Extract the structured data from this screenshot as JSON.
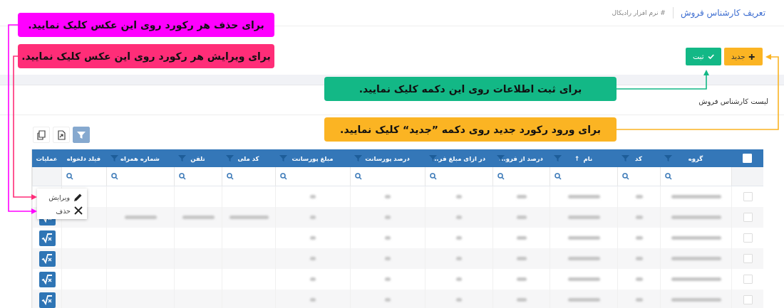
{
  "header": {
    "title": "تعریف کارشناس فروش",
    "breadcrumb": "# نرم افزار رادیکال"
  },
  "actions": [
    {
      "kind": "new",
      "label": "جدید"
    },
    {
      "kind": "save",
      "label": "ثبت"
    }
  ],
  "list_title": "لیست کارشناس فروش",
  "toolbar": [
    {
      "kind": "filter",
      "selected": true
    },
    {
      "kind": "export",
      "selected": false
    },
    {
      "kind": "columns",
      "selected": false
    }
  ],
  "table": {
    "columns": [
      {
        "label": "گروه",
        "filter": true
      },
      {
        "label": "کد",
        "filter": true
      },
      {
        "label": "نام",
        "filter": true,
        "sort_mark": "↑"
      },
      {
        "label": "درصد از فرو...",
        "filter": true
      },
      {
        "label": "در ازای مبلغ فر...",
        "filter": true
      },
      {
        "label": "درصد پورسانت",
        "filter": true
      },
      {
        "label": "مبلغ پورسانت",
        "filter": true
      },
      {
        "label": "کد ملی",
        "filter": true
      },
      {
        "label": "تلفن",
        "filter": true
      },
      {
        "label": "شماره همراه",
        "filter": true
      },
      {
        "label": "فیلد دلخواه",
        "filter": false
      },
      {
        "label": "عملیات",
        "filter": false
      }
    ],
    "header_checked": false,
    "rows": [
      {
        "checked": false,
        "cells": [
          true,
          true,
          true,
          true,
          true,
          true,
          true,
          false,
          false,
          false,
          false
        ],
        "actions_button": false
      },
      {
        "checked": false,
        "cells": [
          true,
          true,
          true,
          true,
          true,
          true,
          true,
          true,
          true,
          true,
          false
        ],
        "actions_button": true
      },
      {
        "checked": false,
        "cells": [
          true,
          true,
          true,
          true,
          true,
          true,
          true,
          false,
          false,
          false,
          false
        ]
      },
      {
        "checked": false,
        "cells": [
          true,
          true,
          true,
          true,
          true,
          true,
          true,
          false,
          false,
          false,
          false
        ]
      },
      {
        "checked": false,
        "cells": [
          true,
          true,
          true,
          true,
          true,
          true,
          true,
          false,
          false,
          false,
          false
        ]
      },
      {
        "checked": false,
        "cells": [
          true,
          true,
          true,
          true,
          true,
          true,
          true,
          false,
          false,
          false,
          false
        ]
      }
    ]
  },
  "row_menu": [
    {
      "kind": "edit",
      "label": "ویرایش"
    },
    {
      "kind": "delete",
      "label": "حذف"
    }
  ],
  "callouts": [
    {
      "text": "برای حذف هر رکورد روی این عکس کلیک نمایید.",
      "color": "#ff00ff"
    },
    {
      "text": "برای ویرایش هر رکورد روی این عکس کلیک نمایید.",
      "color": "#ff2d78"
    },
    {
      "text": "برای ثبت اطلاعات روی این دکمه کلیک نمایید.",
      "color": "#13b886"
    },
    {
      "text": "برای ورود رکورد جدید روی دکمه ”جدید“ کلیک نمایید.",
      "color": "#fbb423"
    }
  ]
}
